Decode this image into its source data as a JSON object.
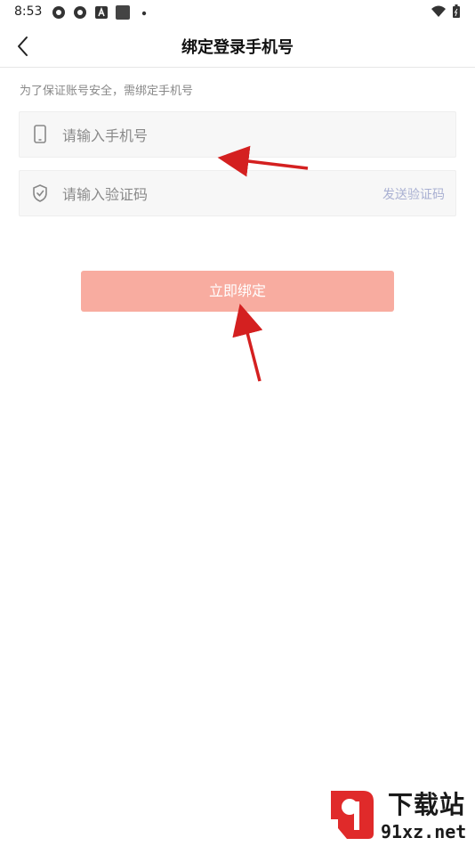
{
  "status_bar": {
    "time": "8:53"
  },
  "header": {
    "title": "绑定登录手机号"
  },
  "hint": "为了保证账号安全，需绑定手机号",
  "phone_field": {
    "placeholder": "请输入手机号",
    "value": ""
  },
  "code_field": {
    "placeholder": "请输入验证码",
    "value": "",
    "send_code_label": "发送验证码"
  },
  "bind_button": {
    "label": "立即绑定"
  },
  "watermark": {
    "title": "下载站",
    "url": "91xz.net"
  },
  "colors": {
    "button": "#f8aca0",
    "send_code": "#a9b0d2",
    "arrow": "#d42020"
  }
}
